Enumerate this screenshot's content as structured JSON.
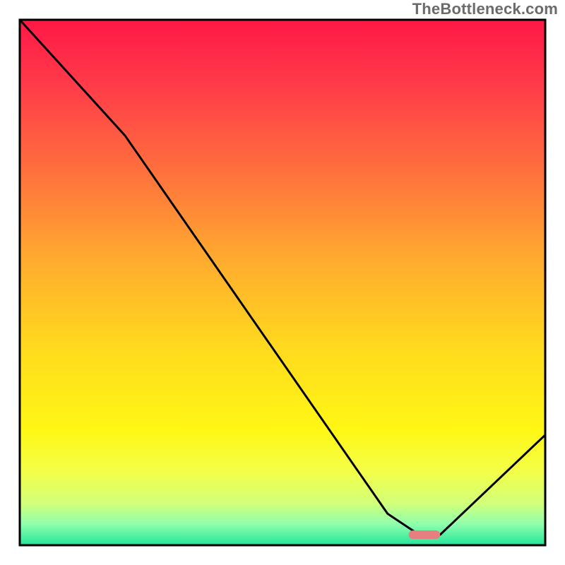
{
  "watermark": "TheBottleneck.com",
  "chart_data": {
    "type": "line",
    "title": "",
    "xlabel": "",
    "ylabel": "",
    "xlim": [
      0,
      100
    ],
    "ylim": [
      0,
      100
    ],
    "grid": false,
    "legend": false,
    "series": [
      {
        "name": "bottleneck-curve",
        "x": [
          0,
          20,
          70,
          76,
          80,
          100
        ],
        "y": [
          100,
          78,
          6,
          2,
          2,
          21
        ]
      }
    ],
    "marker": {
      "name": "optimal-range",
      "x_start": 74,
      "x_end": 80,
      "y": 2,
      "color": "#e77f81"
    },
    "background_gradient": {
      "stops": [
        {
          "offset": 0.0,
          "color": "#ff1846"
        },
        {
          "offset": 0.12,
          "color": "#ff3a49"
        },
        {
          "offset": 0.28,
          "color": "#ff6d3e"
        },
        {
          "offset": 0.45,
          "color": "#ffa92f"
        },
        {
          "offset": 0.62,
          "color": "#ffd91e"
        },
        {
          "offset": 0.78,
          "color": "#fff714"
        },
        {
          "offset": 0.86,
          "color": "#f3ff48"
        },
        {
          "offset": 0.92,
          "color": "#d2ff7a"
        },
        {
          "offset": 0.96,
          "color": "#8fffad"
        },
        {
          "offset": 1.0,
          "color": "#22e59b"
        }
      ]
    },
    "border_color": "#000000",
    "line_color": "#000000"
  }
}
